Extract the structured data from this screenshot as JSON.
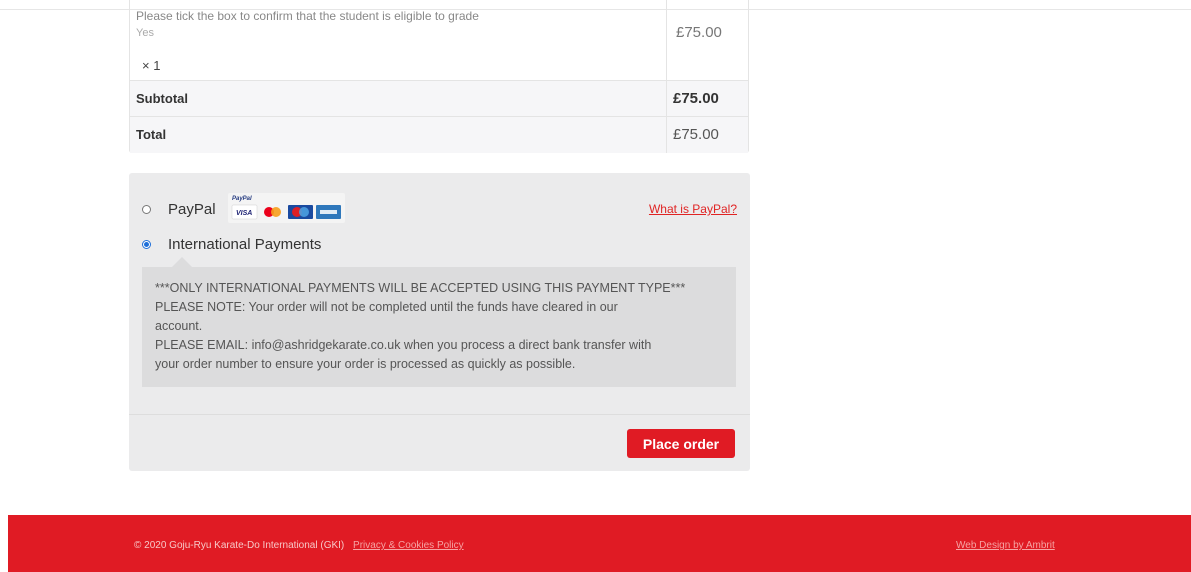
{
  "order": {
    "item_meta_label": "Please tick the box to confirm that the student is eligible to grade",
    "item_meta_value": "Yes",
    "item_quantity": "× 1",
    "item_price": "£75.00",
    "subtotal_label": "Subtotal",
    "subtotal_value": "£75.00",
    "total_label": "Total",
    "total_value": "£75.00"
  },
  "payment": {
    "methods": [
      {
        "label": "PayPal",
        "selected": false
      },
      {
        "label": "International Payments",
        "selected": true
      }
    ],
    "paypal_logo_text": "PayPal",
    "paypal_cards": [
      "VISA",
      "MasterCard",
      "Maestro",
      "AMEX"
    ],
    "what_is_paypal": "What is PayPal?",
    "description_lines": [
      "***ONLY INTERNATIONAL PAYMENTS WILL BE ACCEPTED USING THIS PAYMENT TYPE***",
      "PLEASE NOTE: Your order will not be completed until the funds have cleared in our",
      "account.",
      "PLEASE EMAIL: info@ashridgekarate.co.uk when you process a direct bank transfer with",
      "your order number to ensure your order is processed as quickly as possible."
    ],
    "place_order_label": "Place order"
  },
  "footer": {
    "copyright": "© 2020 Goju-Ryu Karate-Do International (GKI)",
    "privacy_link": "Privacy & Cookies Policy",
    "credit_link": "Web Design by Ambrit"
  },
  "colors": {
    "accent": "#e01b24",
    "radio_selected": "#1e6fd9",
    "panel_bg": "#ebebec"
  }
}
